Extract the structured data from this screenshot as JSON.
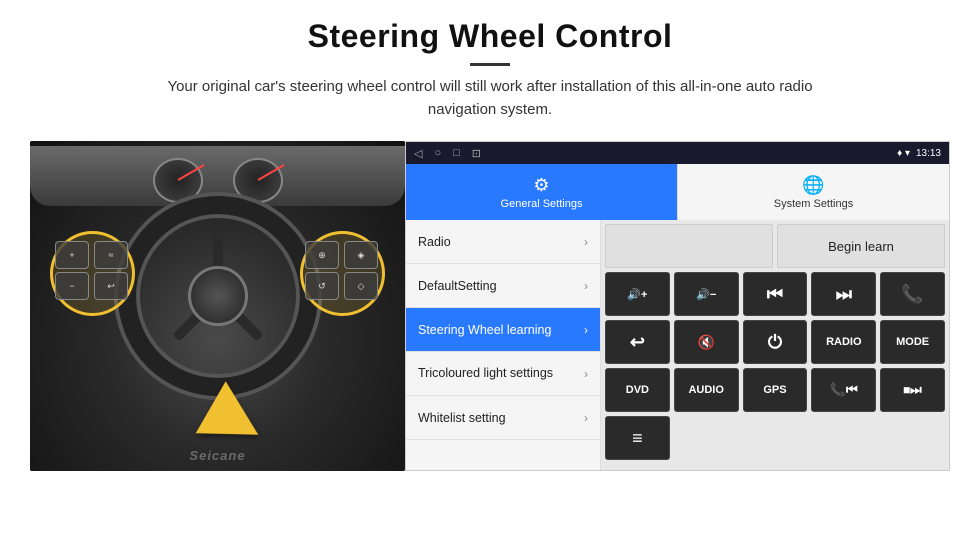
{
  "header": {
    "title": "Steering Wheel Control",
    "subtitle": "Your original car's steering wheel control will still work after installation of this all-in-one auto radio navigation system."
  },
  "status_bar": {
    "nav_icons": [
      "◁",
      "○",
      "□",
      "⊡"
    ],
    "signal_icon": "▼",
    "wifi_icon": "▾",
    "time": "13:13"
  },
  "tabs": [
    {
      "label": "General Settings",
      "icon": "⚙",
      "active": true
    },
    {
      "label": "System Settings",
      "icon": "🌐",
      "active": false
    }
  ],
  "menu_items": [
    {
      "label": "Radio",
      "active": false
    },
    {
      "label": "DefaultSetting",
      "active": false
    },
    {
      "label": "Steering Wheel learning",
      "active": true
    },
    {
      "label": "Tricoloured light settings",
      "active": false
    },
    {
      "label": "Whitelist setting",
      "active": false
    }
  ],
  "begin_learn_label": "Begin learn",
  "control_buttons": {
    "row1": [
      {
        "label": "🔊+",
        "key": "vol-up"
      },
      {
        "label": "🔊-",
        "key": "vol-down"
      },
      {
        "label": "⏮",
        "key": "prev"
      },
      {
        "label": "⏭",
        "key": "next"
      },
      {
        "label": "📞",
        "key": "call"
      }
    ],
    "row2": [
      {
        "label": "↩",
        "key": "back"
      },
      {
        "label": "🔇",
        "key": "mute"
      },
      {
        "label": "⏻",
        "key": "power"
      },
      {
        "label": "RADIO",
        "key": "radio"
      },
      {
        "label": "MODE",
        "key": "mode"
      }
    ],
    "row3": [
      {
        "label": "DVD",
        "key": "dvd"
      },
      {
        "label": "AUDIO",
        "key": "audio"
      },
      {
        "label": "GPS",
        "key": "gps"
      },
      {
        "label": "📞⏮",
        "key": "call-prev"
      },
      {
        "label": "⏹⏭",
        "key": "stop-next"
      }
    ],
    "row4_partial": [
      {
        "label": "≡",
        "key": "menu"
      }
    ]
  },
  "watermark": "Seicane"
}
